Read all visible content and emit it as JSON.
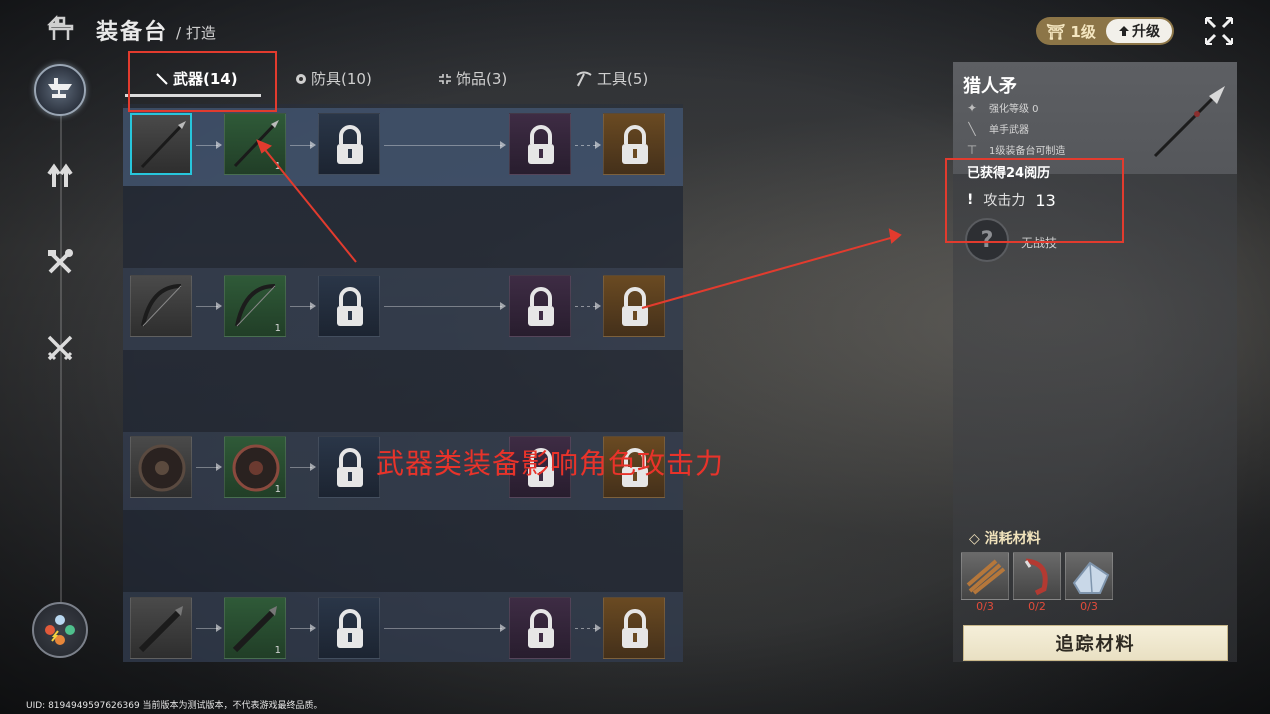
{
  "header": {
    "title": "装备台",
    "subtitle": "/ 打造"
  },
  "tabs": [
    {
      "label": "武器(14)",
      "icon": "sword-icon",
      "active": true
    },
    {
      "label": "防具(10)",
      "icon": "shield-icon",
      "active": false
    },
    {
      "label": "饰品(3)",
      "icon": "ornament-icon",
      "active": false
    },
    {
      "label": "工具(5)",
      "icon": "pickaxe-icon",
      "active": false
    }
  ],
  "sidebar": {
    "items": [
      {
        "name": "forge-anvil-icon",
        "active": true
      },
      {
        "name": "upgrade-arrows-icon",
        "active": false
      },
      {
        "name": "tools-cross-icon",
        "active": false
      },
      {
        "name": "crossed-swords-icon",
        "active": false
      },
      {
        "name": "elements-icon",
        "active": false
      }
    ]
  },
  "level_badge": {
    "level_label": "1级",
    "upgrade_label": "升级"
  },
  "grid": {
    "rows": [
      {
        "weapon": "spear",
        "tiers": [
          "gray",
          "green",
          "locked",
          "locked",
          "locked"
        ],
        "count": "1"
      },
      {
        "weapon": "bow",
        "tiers": [
          "gray",
          "green",
          "locked",
          "locked",
          "locked"
        ],
        "count": "1"
      },
      {
        "weapon": "shield",
        "tiers": [
          "gray",
          "green",
          "locked",
          "locked",
          "locked"
        ],
        "count": "1"
      },
      {
        "weapon": "sword",
        "tiers": [
          "gray",
          "green",
          "locked",
          "locked",
          "locked"
        ],
        "count": "1"
      }
    ]
  },
  "overlay_note": "武器类装备影响角色攻击力",
  "detail": {
    "name": "猎人矛",
    "lines": [
      {
        "icon": "sparkle-icon",
        "text": "强化等级 0"
      },
      {
        "icon": "sword-icon",
        "text": "单手武器"
      },
      {
        "icon": "anvil-icon",
        "text": "1级装备台可制造"
      }
    ],
    "exp_text": "已获得24阅历",
    "attack_label": "攻击力",
    "attack_value": "13",
    "skill_label": "无战技",
    "materials_title": "消耗材料",
    "materials": [
      {
        "icon": "wood-icon",
        "count": "0/3"
      },
      {
        "icon": "horn-icon",
        "count": "0/2"
      },
      {
        "icon": "crystal-icon",
        "count": "0/3"
      }
    ],
    "track_button": "追踪材料"
  },
  "footer": {
    "uid_text": "UID: 8194949597626369 当前版本为测试版本，不代表游戏最终品质。"
  },
  "colors": {
    "annotation_red": "#e23b2e",
    "selected_cyan": "#27c6dc",
    "material_count_red": "#e24b3a"
  }
}
